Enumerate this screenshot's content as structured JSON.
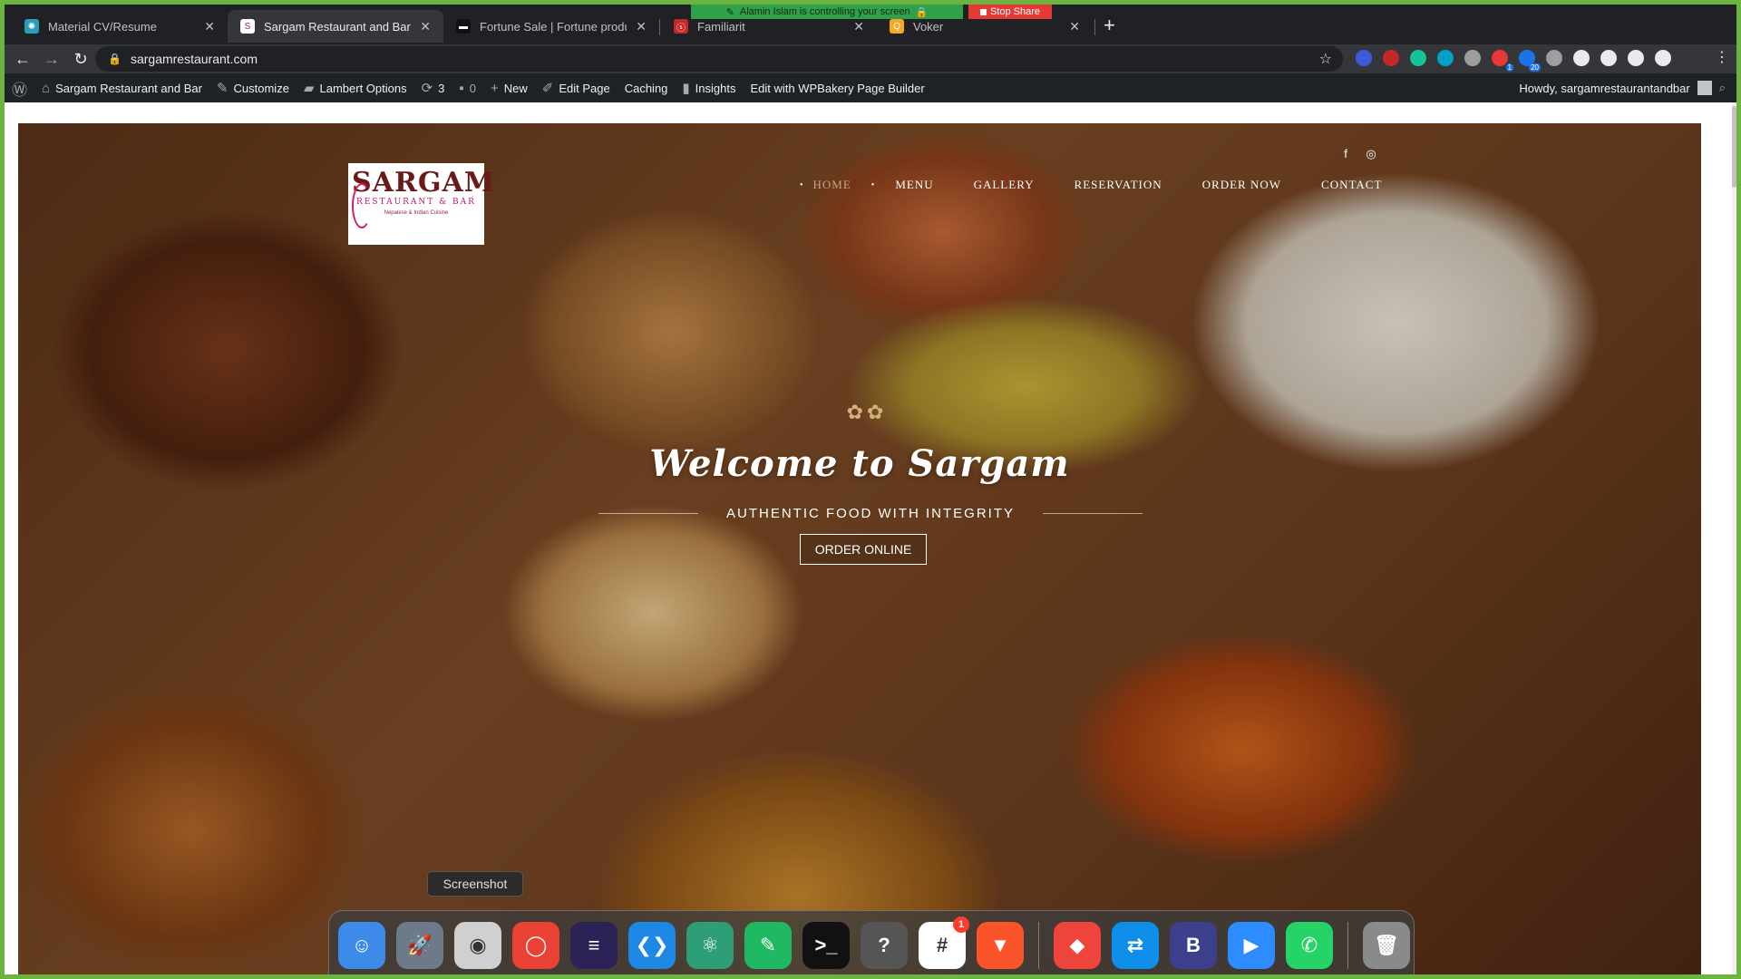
{
  "browser": {
    "tabs": [
      {
        "title": "Material CV/Resume",
        "favicon_color": "#2a9db8"
      },
      {
        "title": "Sargam Restaurant and Bar – Ta",
        "favicon_color": "#ffffff"
      },
      {
        "title": "Fortune Sale | Fortune products",
        "favicon_color": "#111111"
      },
      {
        "title": "Familiarit",
        "favicon_color": "#c62828"
      },
      {
        "title": "Voker",
        "favicon_color": "#f9a825"
      }
    ],
    "close_glyph": "✕",
    "new_tab_glyph": "+",
    "share_banner": "Alamin Islam is controlling your screen",
    "stop_share": "Stop Share",
    "url": "sargamrestaurant.com",
    "extensions": [
      "#3b5bdb",
      "#c62828",
      "#15c39a",
      "#00a3c4",
      "#9e9e9e",
      "#e53935",
      "#1a73e8",
      "#9e9e9e",
      "#e8eaed",
      "#e8eaed",
      "#e8eaed",
      "#e8eaed"
    ],
    "extension_badges": {
      "5": "1",
      "6": "20"
    }
  },
  "wp_admin_bar": {
    "items": [
      {
        "label": "Sargam Restaurant and Bar",
        "icon": "home-icon"
      },
      {
        "label": "Customize",
        "icon": "brush-icon"
      },
      {
        "label": "Lambert Options",
        "icon": "folder-icon"
      },
      {
        "label": "3",
        "icon": "updates-icon"
      },
      {
        "label": "0",
        "icon": "comment-icon"
      },
      {
        "label": "New",
        "icon": "plus-icon"
      },
      {
        "label": "Edit Page",
        "icon": "pencil-icon"
      },
      {
        "label": "Caching",
        "icon": ""
      },
      {
        "label": "Insights",
        "icon": "bar-chart-icon"
      },
      {
        "label": "Edit with WPBakery Page Builder",
        "icon": ""
      }
    ],
    "greeting": "Howdy, sargamrestaurantandbar"
  },
  "site": {
    "logo": {
      "word": "SARGAM",
      "sub": "RESTAURANT & BAR",
      "tagline": "Nepalese & Indian Cuisine"
    },
    "social": [
      "f",
      "◎"
    ],
    "nav": [
      "HOME",
      "MENU",
      "GALLERY",
      "RESERVATION",
      "ORDER NOW",
      "CONTACT"
    ],
    "hero": {
      "title": "Welcome to Sargam",
      "subtitle": "AUTHENTIC FOOD WITH INTEGRITY",
      "button": "ORDER ONLINE"
    }
  },
  "dock": {
    "tooltip": "Screenshot",
    "apps": [
      {
        "name": "Finder",
        "color": "#3d8be8",
        "glyph": "☺"
      },
      {
        "name": "Launchpad",
        "color": "#6c7a89",
        "glyph": "🚀"
      },
      {
        "name": "Screenshot",
        "color": "#d0d0d0",
        "glyph": "◉"
      },
      {
        "name": "Chrome",
        "color": "#e94235",
        "glyph": "◯"
      },
      {
        "name": "Eclipse",
        "color": "#2c2255",
        "glyph": "≡"
      },
      {
        "name": "VS Code",
        "color": "#1e88e5",
        "glyph": "❮❯"
      },
      {
        "name": "Atom",
        "color": "#2e9e77",
        "glyph": "⚛"
      },
      {
        "name": "Evernote",
        "color": "#1fb863",
        "glyph": "✎"
      },
      {
        "name": "Terminal",
        "color": "#111111",
        "glyph": ">_"
      },
      {
        "name": "Help",
        "color": "#555555",
        "glyph": "?"
      },
      {
        "name": "Slack",
        "color": "#ffffff",
        "glyph": "#",
        "badge": "1"
      },
      {
        "name": "Brave",
        "color": "#fb542b",
        "glyph": "▼"
      },
      {
        "name": "AnyDesk",
        "color": "#ef443b",
        "glyph": "◆"
      },
      {
        "name": "TeamViewer",
        "color": "#0e8ee9",
        "glyph": "⇄"
      },
      {
        "name": "BBEdit",
        "color": "#3b3f8c",
        "glyph": "B"
      },
      {
        "name": "Zoom",
        "color": "#2d8cff",
        "glyph": "▶"
      },
      {
        "name": "WhatsApp",
        "color": "#25d366",
        "glyph": "✆"
      },
      {
        "name": "Trash",
        "color": "#8a8a8a",
        "glyph": "🗑"
      }
    ]
  }
}
